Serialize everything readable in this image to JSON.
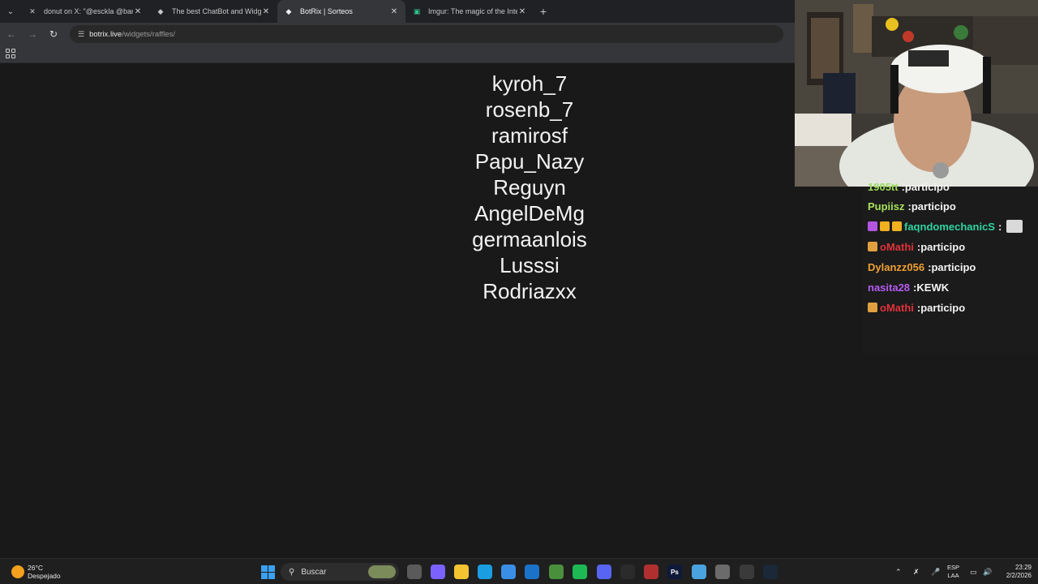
{
  "browser": {
    "tabs": [
      {
        "title": "donut on X: \"@esckla @banana",
        "icon": "x-logo-icon",
        "active": false
      },
      {
        "title": "The best ChatBot and Widgets",
        "icon": "botrix-icon",
        "active": false
      },
      {
        "title": "BotRix | Sorteos",
        "icon": "botrix-icon",
        "active": true
      },
      {
        "title": "Imgur: The magic of the Interne",
        "icon": "imgur-icon",
        "active": false
      }
    ],
    "url_host": "botrix.live",
    "url_path": "/widgets/raffles/"
  },
  "raffle": {
    "winners": [
      "kyroh_7",
      "rosenb_7",
      "ramirosf",
      "Papu_Nazy",
      "Reguyn",
      "AngelDeMg",
      "germaanlois",
      "Lusssi",
      "Rodriazxx"
    ]
  },
  "chat": {
    "lines": [
      {
        "user": "1905tt",
        "message": "participo",
        "color": "#9bdc5a",
        "badges": []
      },
      {
        "user": "Pupiisz",
        "message": "participo",
        "color": "#a8e05c",
        "badges": []
      },
      {
        "user": "faqndomechanicS",
        "message": "",
        "color": "#2fd3a0",
        "badges": [
          "#b455e0",
          "#f0b020",
          "#f0b020"
        ],
        "emote": true
      },
      {
        "user": "oMathi",
        "message": "participo",
        "color": "#e0323a",
        "badges": [
          "#e0a040"
        ]
      },
      {
        "user": "Dylanzz056",
        "message": "participo",
        "color": "#f0a030",
        "badges": []
      },
      {
        "user": "nasita28",
        "message": "KEWK",
        "color": "#b45cf0",
        "badges": []
      },
      {
        "user": "oMathi",
        "message": "participo",
        "color": "#e0323a",
        "badges": [
          "#e0a040"
        ]
      }
    ]
  },
  "taskbar": {
    "weather_temp": "26°C",
    "weather_desc": "Despejado",
    "search_placeholder": "Buscar",
    "lang_line1": "ESP",
    "lang_line2": "LAA",
    "time": "23:29",
    "date": "2/2/2026",
    "pinned": [
      {
        "name": "task-view-icon",
        "color": "#5a5a5a",
        "glyph": ""
      },
      {
        "name": "copilot-icon",
        "color": "#7b61ff",
        "glyph": ""
      },
      {
        "name": "file-explorer-icon",
        "color": "#f4c430",
        "glyph": ""
      },
      {
        "name": "edge-icon",
        "color": "#1b9de2",
        "glyph": ""
      },
      {
        "name": "store-icon",
        "color": "#3a8ee6",
        "glyph": ""
      },
      {
        "name": "outlook-icon",
        "color": "#1a73c9",
        "glyph": ""
      },
      {
        "name": "chrome-icon",
        "color": "#4a8f3c",
        "glyph": ""
      },
      {
        "name": "spotify-icon",
        "color": "#1db954",
        "glyph": ""
      },
      {
        "name": "discord-icon",
        "color": "#5865f2",
        "glyph": ""
      },
      {
        "name": "obs-icon",
        "color": "#2b2b2b",
        "glyph": ""
      },
      {
        "name": "media-app-icon",
        "color": "#b03030",
        "glyph": ""
      },
      {
        "name": "photoshop-icon",
        "color": "#0f1a3a",
        "glyph": "Ps"
      },
      {
        "name": "notepad-icon",
        "color": "#4aa3df",
        "glyph": ""
      },
      {
        "name": "settings-icon",
        "color": "#6b6b6b",
        "glyph": ""
      },
      {
        "name": "app-icon",
        "color": "#3a3a3a",
        "glyph": ""
      },
      {
        "name": "steam-icon",
        "color": "#1b2838",
        "glyph": ""
      }
    ]
  }
}
